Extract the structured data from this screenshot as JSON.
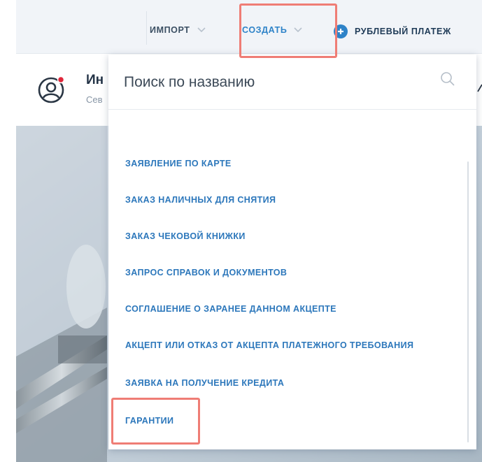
{
  "topbar": {
    "import_label": "ИМПОРТ",
    "create_label": "СОЗДАТЬ",
    "ruble_payment_label": "РУБЛЕВЫЙ ПЛАТЕЖ"
  },
  "profile": {
    "org_name": "Ин",
    "org_sub": "Сев"
  },
  "dropdown": {
    "search_placeholder": "Поиск по названию",
    "items": [
      "ЗАЯВЛЕНИЕ ПО КАРТЕ",
      "ЗАКАЗ НАЛИЧНЫХ ДЛЯ СНЯТИЯ",
      "ЗАКАЗ ЧЕКОВОЙ КНИЖКИ",
      "ЗАПРОС СПРАВОК И ДОКУМЕНТОВ",
      "СОГЛАШЕНИЕ О ЗАРАНЕЕ ДАННОМ АКЦЕПТЕ",
      "АКЦЕПТ ИЛИ ОТКАЗ ОТ АКЦЕПТА ПЛАТЕЖНОГО ТРЕБОВАНИЯ",
      "ЗАЯВКА НА ПОЛУЧЕНИЕ КРЕДИТА",
      "ГАРАНТИИ"
    ]
  },
  "colors": {
    "accent": "#2e83c8",
    "highlight": "#ef7d75",
    "notification_dot": "#e0263a"
  },
  "icons": [
    "chevron-down-icon",
    "plus-circle-icon",
    "user-avatar-icon",
    "search-icon"
  ]
}
